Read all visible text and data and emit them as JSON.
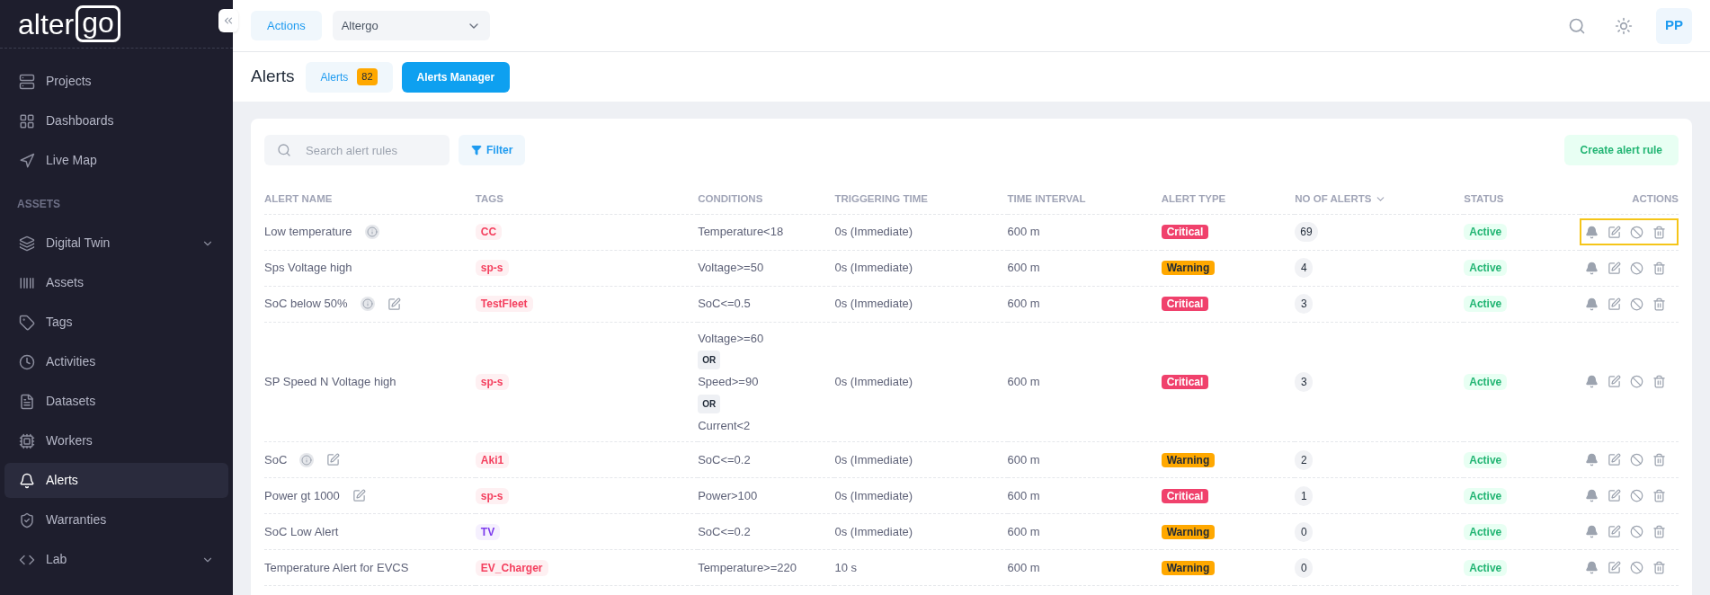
{
  "logo": {
    "text": "alter",
    "boxed": "go"
  },
  "sidebar": {
    "sections": [
      {
        "items": [
          {
            "label": "Projects",
            "selected": false
          },
          {
            "label": "Dashboards",
            "selected": false
          },
          {
            "label": "Live Map",
            "selected": false
          }
        ]
      },
      {
        "title": "ASSETS",
        "items": [
          {
            "label": "Digital Twin",
            "selected": false,
            "expanded": false
          },
          {
            "label": "Assets",
            "selected": false
          },
          {
            "label": "Tags",
            "selected": false
          },
          {
            "label": "Activities",
            "selected": false
          },
          {
            "label": "Datasets",
            "selected": false
          },
          {
            "label": "Workers",
            "selected": false
          },
          {
            "label": "Alerts",
            "selected": true
          },
          {
            "label": "Warranties",
            "selected": false
          },
          {
            "label": "Lab",
            "selected": false,
            "expanded": false
          }
        ]
      }
    ]
  },
  "topbar": {
    "actions": "Actions",
    "org_select": {
      "value": "Altergo"
    },
    "avatar": "PP"
  },
  "page": {
    "title": "Alerts",
    "tabs": [
      {
        "label": "Alerts",
        "badge": "82",
        "selected": false
      },
      {
        "label": "Alerts Manager",
        "selected": true
      }
    ]
  },
  "toolbar": {
    "search": {
      "placeholder": "Search alert rules"
    },
    "filter": "Filter",
    "create": "Create alert rule"
  },
  "table": {
    "columns": [
      {
        "label": "ALERT NAME"
      },
      {
        "label": "TAGS"
      },
      {
        "label": "CONDITIONS"
      },
      {
        "label": "TRIGGERING TIME"
      },
      {
        "label": "TIME INTERVAL"
      },
      {
        "label": "ALERT TYPE"
      },
      {
        "label": "NO OF ALERTS",
        "sorted": true
      },
      {
        "label": "STATUS"
      },
      {
        "label": "ACTIONS"
      }
    ],
    "rows": [
      {
        "name": "Low temperature",
        "info": true,
        "editable": false,
        "tag": {
          "label": "CC",
          "color": "#f43f5e"
        },
        "conditions": [
          {
            "kind": "expr",
            "text": "Temperature<18"
          }
        ],
        "triggering": "0s (Immediate)",
        "interval": "600 m",
        "type": {
          "kind": "critical",
          "label": "Critical"
        },
        "count": "69",
        "status": "Active",
        "highlighted": true
      },
      {
        "name": "Sps Voltage high",
        "info": false,
        "editable": false,
        "tag": {
          "label": "sp-s",
          "color": "#f43f5e"
        },
        "conditions": [
          {
            "kind": "expr",
            "text": "Voltage>=50"
          }
        ],
        "triggering": "0s (Immediate)",
        "interval": "600 m",
        "type": {
          "kind": "warning",
          "label": "Warning"
        },
        "count": "4",
        "status": "Active",
        "highlighted": false
      },
      {
        "name": "SoC below 50%",
        "info": true,
        "editable": true,
        "tag": {
          "label": "TestFleet",
          "color": "#f43f5e"
        },
        "conditions": [
          {
            "kind": "expr",
            "text": "SoC<=0.5"
          }
        ],
        "triggering": "0s (Immediate)",
        "interval": "600 m",
        "type": {
          "kind": "critical",
          "label": "Critical"
        },
        "count": "3",
        "status": "Active",
        "highlighted": false
      },
      {
        "name": "SP Speed N Voltage high",
        "info": false,
        "editable": false,
        "tag": {
          "label": "sp-s",
          "color": "#f43f5e"
        },
        "conditions": [
          {
            "kind": "expr",
            "text": "Voltage>=60"
          },
          {
            "kind": "op",
            "text": "OR"
          },
          {
            "kind": "expr",
            "text": "Speed>=90"
          },
          {
            "kind": "op",
            "text": "OR"
          },
          {
            "kind": "expr",
            "text": "Current<2"
          }
        ],
        "triggering": "0s (Immediate)",
        "interval": "600 m",
        "type": {
          "kind": "critical",
          "label": "Critical"
        },
        "count": "3",
        "status": "Active",
        "highlighted": false
      },
      {
        "name": "SoC",
        "info": true,
        "editable": true,
        "tag": {
          "label": "Aki1",
          "color": "#f43f5e"
        },
        "conditions": [
          {
            "kind": "expr",
            "text": "SoC<=0.2"
          }
        ],
        "triggering": "0s (Immediate)",
        "interval": "600 m",
        "type": {
          "kind": "warning",
          "label": "Warning"
        },
        "count": "2",
        "status": "Active",
        "highlighted": false
      },
      {
        "name": "Power gt 1000",
        "info": false,
        "editable": true,
        "tag": {
          "label": "sp-s",
          "color": "#f43f5e"
        },
        "conditions": [
          {
            "kind": "expr",
            "text": "Power>100"
          }
        ],
        "triggering": "0s (Immediate)",
        "interval": "600 m",
        "type": {
          "kind": "critical",
          "label": "Critical"
        },
        "count": "1",
        "status": "Active",
        "highlighted": false
      },
      {
        "name": "SoC Low Alert",
        "info": false,
        "editable": false,
        "tag": {
          "label": "TV",
          "color": "#7c3aed"
        },
        "conditions": [
          {
            "kind": "expr",
            "text": "SoC<=0.2"
          }
        ],
        "triggering": "0s (Immediate)",
        "interval": "600 m",
        "type": {
          "kind": "warning",
          "label": "Warning"
        },
        "count": "0",
        "status": "Active",
        "highlighted": false
      },
      {
        "name": "Temperature Alert for EVCS",
        "info": false,
        "editable": false,
        "tag": {
          "label": "EV_Charger",
          "color": "#f43f5e"
        },
        "conditions": [
          {
            "kind": "expr",
            "text": "Temperature>=220"
          }
        ],
        "triggering": "10 s",
        "interval": "600 m",
        "type": {
          "kind": "warning",
          "label": "Warning"
        },
        "count": "0",
        "status": "Active",
        "highlighted": false
      }
    ]
  }
}
